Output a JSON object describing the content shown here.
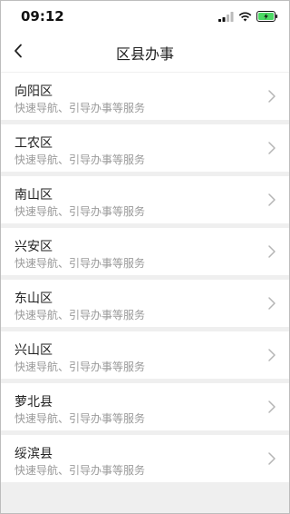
{
  "status_bar": {
    "time": "09:12"
  },
  "nav": {
    "title": "区县办事"
  },
  "districts": [
    {
      "name": "向阳区",
      "desc": "快速导航、引导办事等服务"
    },
    {
      "name": "工农区",
      "desc": "快速导航、引导办事等服务"
    },
    {
      "name": "南山区",
      "desc": "快速导航、引导办事等服务"
    },
    {
      "name": "兴安区",
      "desc": "快速导航、引导办事等服务"
    },
    {
      "name": "东山区",
      "desc": "快速导航、引导办事等服务"
    },
    {
      "name": "兴山区",
      "desc": "快速导航、引导办事等服务"
    },
    {
      "name": "萝北县",
      "desc": "快速导航、引导办事等服务"
    },
    {
      "name": "绥滨县",
      "desc": "快速导航、引导办事等服务"
    }
  ],
  "icons": {
    "back": "chevron-left-icon",
    "item_arrow": "chevron-right-icon",
    "signal": "signal-icon",
    "wifi": "wifi-icon",
    "battery": "battery-charging-icon"
  },
  "colors": {
    "battery_fill": "#4cd964",
    "background": "#efefef"
  }
}
